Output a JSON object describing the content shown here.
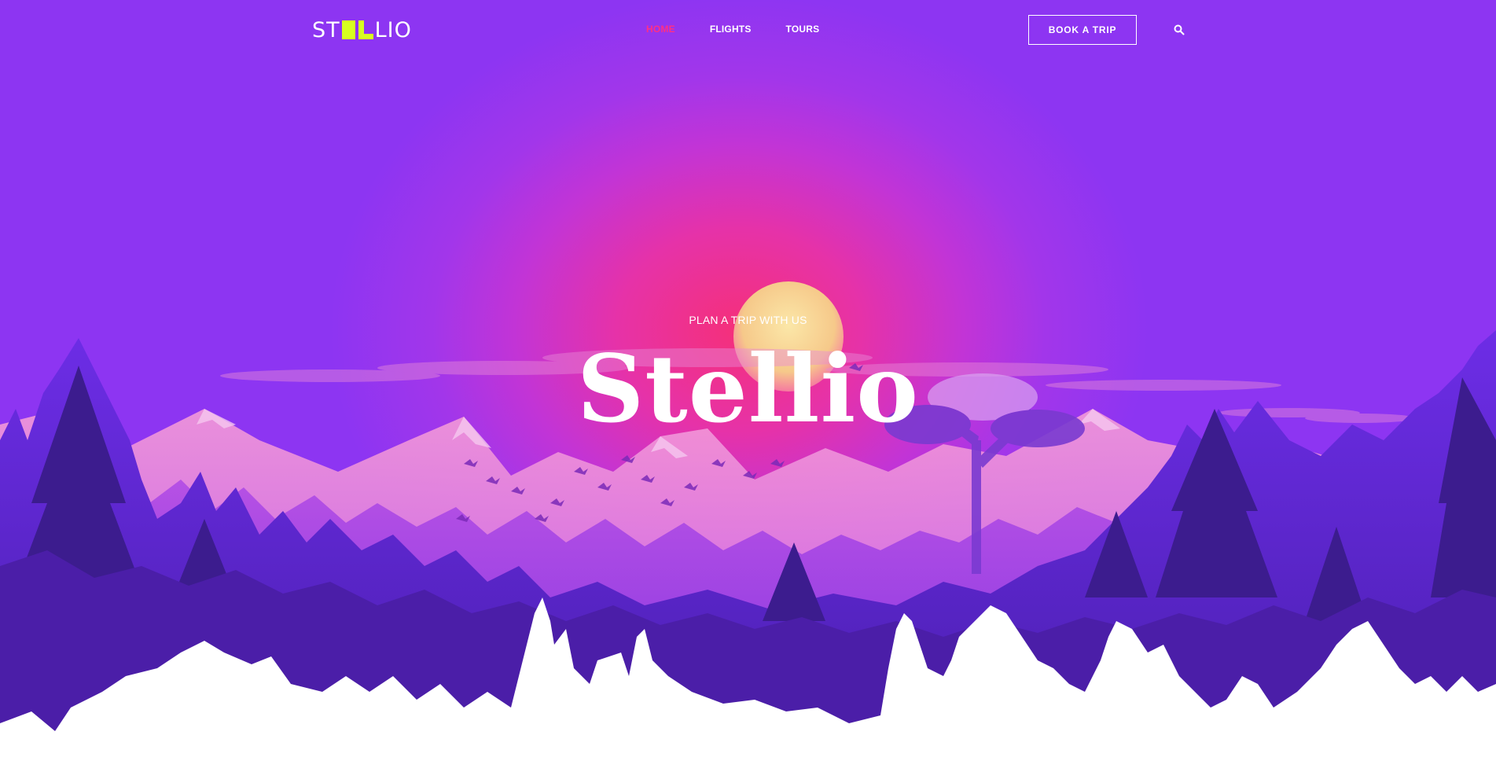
{
  "brand": {
    "logo_left": "ST",
    "logo_right": "LIO",
    "logo_alt": "STELLIO",
    "accent_color": "#d7ff1f"
  },
  "nav": {
    "items": [
      {
        "label": "HOME",
        "active": true
      },
      {
        "label": "FLIGHTS",
        "active": false
      },
      {
        "label": "TOURS",
        "active": false
      }
    ],
    "active_color": "#ff2f86"
  },
  "header": {
    "cta_label": "BOOK A TRIP",
    "search_icon": "search-icon"
  },
  "hero": {
    "subtitle": "PLAN A TRIP WITH US",
    "title": "Stellio"
  },
  "colors": {
    "sky_center": "#f5307a",
    "sky_edge": "#8d35f2",
    "sun": "#f7d98c",
    "forest_dark": "#3a1a8a",
    "forest_mid": "#6a2be0",
    "snow": "#ffffff"
  }
}
